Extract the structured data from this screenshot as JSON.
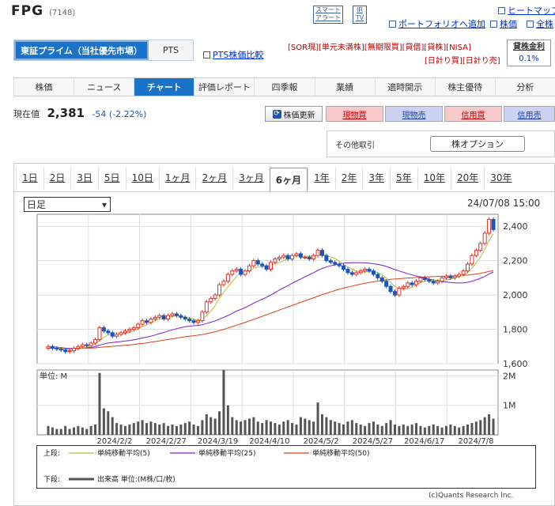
{
  "header": {
    "title": "FPG",
    "code": "(7148)"
  },
  "top_buttons": {
    "smart": [
      "スマート",
      "アラート"
    ],
    "ir": [
      "IR",
      "TV"
    ]
  },
  "top_links": {
    "heatmap": "ヒートマップ",
    "portfolio": "ポートフォリオへ追加",
    "kabuka": "株価",
    "zenkabu": "全株"
  },
  "market_tabs": {
    "active": "東証プライム（当社優先市場）",
    "pts": "PTS",
    "pts_compare": "PTS株価比較"
  },
  "tags": {
    "line1": [
      "[SOR現]",
      "[単元未満株]",
      "[無期限買]",
      "[貸借]",
      "[貸株]",
      "[NISA]"
    ],
    "line2": [
      "[日計り買]",
      "[日計り売]"
    ]
  },
  "lending": {
    "label": "貸株金利",
    "rate": "0.1%"
  },
  "nav": [
    "株価",
    "ニュース",
    "チャート",
    "評価レポート",
    "四季報",
    "業績",
    "適時開示",
    "株主優待",
    "分析"
  ],
  "nav_active": "チャート",
  "quote": {
    "label": "現在値",
    "price": "2,381",
    "change": "-54 (-2.22%)"
  },
  "buttons": {
    "update": "株価更新",
    "buy_spot": "現物買",
    "sell_spot": "現物売",
    "buy_margin": "信用買",
    "sell_margin": "信用売"
  },
  "other_trade": {
    "label": "その他取引",
    "option": "株オプション"
  },
  "periods": [
    "1日",
    "2日",
    "3日",
    "5日",
    "10日",
    "1ヶ月",
    "2ヶ月",
    "3ヶ月",
    "6ヶ月",
    "1年",
    "2年",
    "3年",
    "5年",
    "10年",
    "20年",
    "30年"
  ],
  "period_active": "6ヶ月",
  "interval_select": "日足",
  "chart_timestamp": "24/07/08 15:00",
  "colors": {
    "up": "#e0302a",
    "down": "#1a56b8",
    "ma5": "#b9bf3a",
    "ma25": "#7b1fc9",
    "ma50": "#d9421c",
    "volume": "#555555",
    "accent": "#1a73c8"
  },
  "chart_data": {
    "type": "candlestick",
    "x_tick_labels": [
      "2024/2/2",
      "2024/2/27",
      "2024/3/19",
      "2024/4/10",
      "2024/5/2",
      "2024/5/27",
      "2024/6/17",
      "2024/7/8"
    ],
    "y_ticks": [
      "2,400",
      "2,200",
      "2,000",
      "1,800",
      "1,600"
    ],
    "ylim": [
      1600,
      2470
    ],
    "volume_label": "単位: M",
    "volume_ticks": [
      "2M",
      "1M"
    ],
    "volume_ylim": [
      0,
      2.2
    ],
    "close_series": [
      1700,
      1690,
      1685,
      1680,
      1670,
      1675,
      1690,
      1700,
      1710,
      1705,
      1720,
      1740,
      1810,
      1790,
      1780,
      1760,
      1770,
      1780,
      1790,
      1800,
      1810,
      1830,
      1850,
      1840,
      1860,
      1870,
      1880,
      1860,
      1880,
      1890,
      1880,
      1870,
      1860,
      1850,
      1840,
      1850,
      1900,
      1960,
      1980,
      2000,
      2060,
      2080,
      2120,
      2140,
      2150,
      2120,
      2140,
      2170,
      2200,
      2180,
      2170,
      2150,
      2190,
      2210,
      2220,
      2230,
      2210,
      2230,
      2240,
      2220,
      2220,
      2210,
      2230,
      2260,
      2230,
      2200,
      2190,
      2180,
      2170,
      2150,
      2130,
      2120,
      2130,
      2140,
      2150,
      2140,
      2120,
      2100,
      2080,
      2050,
      2020,
      2000,
      2040,
      2050,
      2070,
      2060,
      2080,
      2100,
      2090,
      2080,
      2070,
      2080,
      2100,
      2110,
      2100,
      2110,
      2120,
      2140,
      2180,
      2230,
      2260,
      2300,
      2360,
      2440,
      2381
    ],
    "ma5": [
      1700,
      1697,
      1693,
      1690,
      1685,
      1680,
      1680,
      1684,
      1691,
      1696,
      1705,
      1715,
      1737,
      1753,
      1768,
      1776,
      1780,
      1776,
      1776,
      1780,
      1790,
      1802,
      1816,
      1826,
      1838,
      1850,
      1860,
      1862,
      1868,
      1876,
      1878,
      1876,
      1874,
      1868,
      1858,
      1852,
      1860,
      1880,
      1906,
      1938,
      1980,
      2016,
      2048,
      2076,
      2110,
      2130,
      2136,
      2144,
      2156,
      2162,
      2164,
      2164,
      2174,
      2182,
      2188,
      2200,
      2212,
      2222,
      2228,
      2226,
      2224,
      2226,
      2226,
      2236,
      2234,
      2230,
      2222,
      2212,
      2196,
      2178,
      2164,
      2150,
      2140,
      2134,
      2134,
      2136,
      2136,
      2130,
      2118,
      2098,
      2074,
      2050,
      2038,
      2032,
      2036,
      2046,
      2060,
      2072,
      2080,
      2084,
      2086,
      2086,
      2086,
      2088,
      2092,
      2100,
      2108,
      2116,
      2130,
      2156,
      2186,
      2222,
      2266,
      2318,
      2356
    ],
    "ma25": [
      1700,
      1698,
      1696,
      1694,
      1690,
      1689,
      1689,
      1690,
      1692,
      1693,
      1695,
      1699,
      1708,
      1714,
      1720,
      1723,
      1726,
      1729,
      1732,
      1735,
      1739,
      1744,
      1750,
      1754,
      1760,
      1767,
      1775,
      1782,
      1790,
      1797,
      1804,
      1810,
      1815,
      1818,
      1821,
      1823,
      1827,
      1834,
      1841,
      1849,
      1859,
      1870,
      1881,
      1893,
      1906,
      1916,
      1927,
      1939,
      1952,
      1964,
      1976,
      1987,
      2000,
      2014,
      2028,
      2042,
      2055,
      2068,
      2081,
      2093,
      2106,
      2118,
      2130,
      2143,
      2154,
      2163,
      2170,
      2176,
      2181,
      2185,
      2187,
      2188,
      2188,
      2188,
      2187,
      2185,
      2182,
      2178,
      2173,
      2166,
      2157,
      2148,
      2140,
      2132,
      2124,
      2117,
      2110,
      2104,
      2098,
      2092,
      2087,
      2082,
      2078,
      2075,
      2073,
      2071,
      2070,
      2071,
      2074,
      2080,
      2088,
      2097,
      2108,
      2122,
      2134
    ],
    "ma50": [
      1690,
      1690,
      1690,
      1690,
      1689,
      1689,
      1689,
      1689,
      1690,
      1690,
      1691,
      1692,
      1695,
      1697,
      1699,
      1701,
      1703,
      1705,
      1707,
      1709,
      1712,
      1715,
      1718,
      1721,
      1725,
      1729,
      1733,
      1737,
      1741,
      1745,
      1749,
      1753,
      1757,
      1760,
      1763,
      1766,
      1770,
      1775,
      1780,
      1786,
      1793,
      1800,
      1808,
      1816,
      1824,
      1832,
      1840,
      1849,
      1858,
      1867,
      1876,
      1885,
      1894,
      1903,
      1912,
      1921,
      1930,
      1939,
      1948,
      1957,
      1966,
      1975,
      1984,
      1993,
      2002,
      2010,
      2018,
      2026,
      2033,
      2040,
      2046,
      2052,
      2058,
      2063,
      2068,
      2073,
      2077,
      2081,
      2085,
      2088,
      2091,
      2093,
      2095,
      2097,
      2099,
      2100,
      2102,
      2103,
      2105,
      2106,
      2107,
      2108,
      2109,
      2110,
      2111,
      2112,
      2113,
      2114,
      2116,
      2119,
      2122,
      2126,
      2131,
      2137,
      2142
    ],
    "volume": [
      0.3,
      0.25,
      0.2,
      0.2,
      0.3,
      0.2,
      0.25,
      0.3,
      0.25,
      0.2,
      0.3,
      0.35,
      2.1,
      0.9,
      0.8,
      0.6,
      0.4,
      0.35,
      0.3,
      0.35,
      0.4,
      0.45,
      0.5,
      0.4,
      0.45,
      0.4,
      0.35,
      0.4,
      0.3,
      0.35,
      0.3,
      0.35,
      0.4,
      0.45,
      0.35,
      0.3,
      0.5,
      0.7,
      0.6,
      0.55,
      0.8,
      2.2,
      1.0,
      0.6,
      0.5,
      0.45,
      0.5,
      0.55,
      0.6,
      0.45,
      0.4,
      0.5,
      0.45,
      0.4,
      0.35,
      0.45,
      0.5,
      0.4,
      0.35,
      0.6,
      0.55,
      0.5,
      0.45,
      1.1,
      0.7,
      0.6,
      0.5,
      0.45,
      0.4,
      0.35,
      0.45,
      0.5,
      0.4,
      0.35,
      0.3,
      0.4,
      0.45,
      0.35,
      0.3,
      0.4,
      0.5,
      0.35,
      0.3,
      0.35,
      0.3,
      0.35,
      0.4,
      0.3,
      0.25,
      0.3,
      0.35,
      0.3,
      0.25,
      0.3,
      0.35,
      0.3,
      0.25,
      0.3,
      0.35,
      0.4,
      0.45,
      0.5,
      0.6,
      0.7,
      0.55
    ]
  },
  "legend": {
    "upper_label": "上段:",
    "ma5_label": "単純移動平均(5)",
    "ma25_label": "単純移動平均(25)",
    "ma50_label": "単純移動平均(50)",
    "lower_label": "下段:",
    "volume_label": "出来高 単位:(M株/口/枚)"
  },
  "copyright": "(c)Quants Research Inc."
}
